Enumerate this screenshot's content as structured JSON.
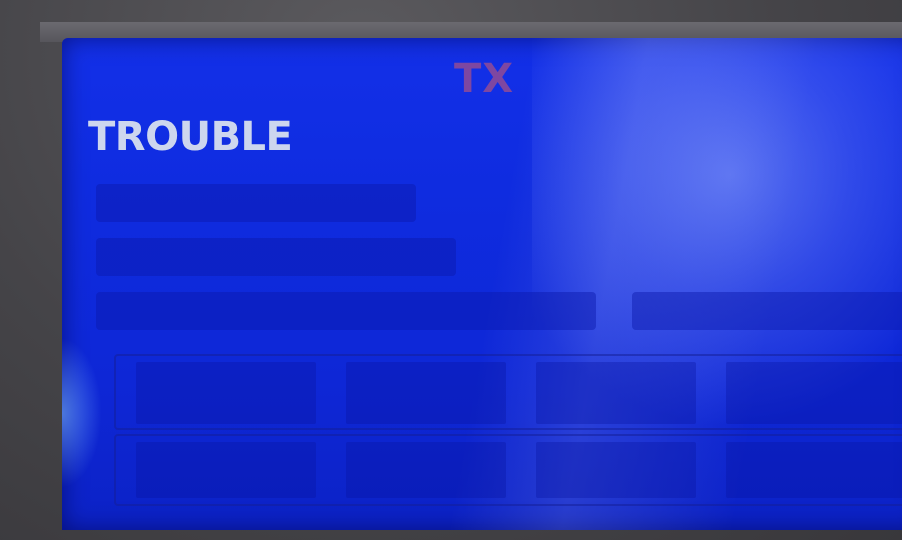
{
  "display": {
    "title": "TX",
    "status": "TROUBLE"
  },
  "colors": {
    "screen_blue": "#1330e8",
    "title_color": "#8a4a9a",
    "status_color": "#cdd6ee"
  }
}
